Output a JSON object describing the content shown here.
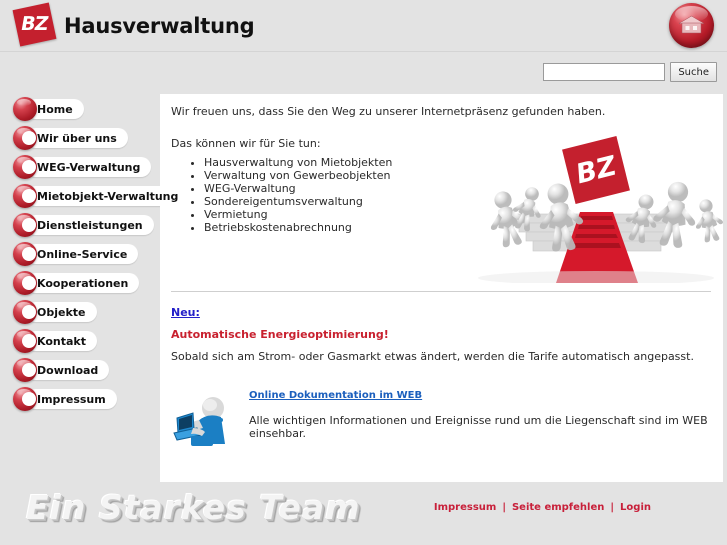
{
  "header": {
    "logo_text": "BZ",
    "site_title": "Hausverwaltung",
    "house_button_name": "house-icon"
  },
  "search": {
    "value": "",
    "placeholder": "",
    "button_label": "Suche"
  },
  "sidebar": {
    "items": [
      {
        "label": "Home",
        "active": true
      },
      {
        "label": "Wir über uns",
        "active": false
      },
      {
        "label": "WEG-Verwaltung",
        "active": false
      },
      {
        "label": "Mietobjekt-Verwaltung",
        "active": false
      },
      {
        "label": "Dienstleistungen",
        "active": false
      },
      {
        "label": "Online-Service",
        "active": false
      },
      {
        "label": "Kooperationen",
        "active": false
      },
      {
        "label": "Objekte",
        "active": false
      },
      {
        "label": "Kontakt",
        "active": false
      },
      {
        "label": "Download",
        "active": false
      },
      {
        "label": "Impressum",
        "active": false
      }
    ]
  },
  "main": {
    "intro": "Wir freuen uns, dass Sie den Weg zu unserer Internetpräsenz gefunden haben.",
    "subhead": "Das können wir für Sie tun:",
    "services": [
      "Hausverwaltung von Mietobjekten",
      "Verwaltung von Gewerbeobjekten",
      "WEG-Verwaltung",
      "Sondereigentumsverwaltung",
      "Vermietung",
      "Betriebskostenabrechnung"
    ],
    "hero_logo_text": "BZ",
    "neu_link": "Neu:",
    "news_headline": "Automatische Energieoptimierung!",
    "news_body": "Sobald sich am Strom- oder Gasmarkt etwas ändert, werden die Tarife automatisch angepasst.",
    "doc_link": "Online Dokumentation im WEB",
    "doc_text": "Alle wichtigen Informationen und Ereignisse rund um die Liegenschaft sind im WEB einsehbar."
  },
  "footer": {
    "slogan": "Ein Starkes Team",
    "links": [
      {
        "label": "Impressum"
      },
      {
        "label": "Seite empfehlen"
      },
      {
        "label": "Login"
      }
    ],
    "separator": "|"
  },
  "colors": {
    "brand_red": "#c4202e",
    "link_blue": "#2420c9",
    "doc_link_blue": "#1b5fbd",
    "news_red": "#c8202e",
    "footer_link_red": "#c8203a",
    "page_bg": "#e3e3e3",
    "panel_bg": "#ffffff"
  }
}
